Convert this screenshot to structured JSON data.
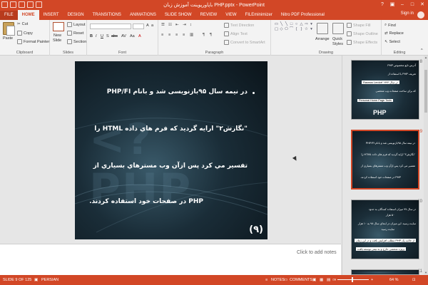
{
  "window": {
    "title": "PHP.pptx - PowerPoint",
    "title_rtl_prefix": "باپاورپوینت آموزش زبان"
  },
  "tabs": [
    "FILE",
    "HOME",
    "INSERT",
    "DESIGN",
    "TRANSITIONS",
    "ANIMATIONS",
    "SLIDE SHOW",
    "REVIEW",
    "VIEW",
    "FILEminimizer",
    "Nitro PDF Professional"
  ],
  "active_tab": "HOME",
  "account": {
    "signin": "Sign in"
  },
  "ribbon": {
    "clipboard": {
      "label": "Clipboard",
      "paste": "Paste",
      "cut": "Cut",
      "copy": "Copy",
      "format_painter": "Format Painter"
    },
    "slides": {
      "label": "Slides",
      "new_slide": "New",
      "new_slide2": "Slide",
      "layout": "Layout",
      "reset": "Reset",
      "section": "Section"
    },
    "font": {
      "label": "Font"
    },
    "paragraph": {
      "label": "Paragraph",
      "text_direction": "Text Direction",
      "align_text": "Align Text",
      "convert_smartart": "Convert to SmartArt"
    },
    "drawing": {
      "label": "Drawing",
      "arrange": "Arrange",
      "quick_styles": "Quick",
      "quick_styles2": "Styles",
      "shape_fill": "Shape Fill",
      "shape_outline": "Shape Outline",
      "shape_effects": "Shape Effects"
    },
    "editing": {
      "label": "Editing",
      "find": "Find",
      "replace": "Replace",
      "select": "Select"
    }
  },
  "slide": {
    "lines": [
      "در نیمه سال ۹۵بازنویسی شد و بانام PHP/FI",
      "\"نگارش۲\" ارایه گردید که فرم هاي داده HTML را",
      "تفسیر مي کرد پس ازآن وب مسترهاي بسیاري از",
      "PHP در صفحات خود استفاده کردند."
    ],
    "number": "(۹)",
    "background_word": "<? PHP"
  },
  "notes_placeholder": "Click to add notes",
  "thumbnails": [
    {
      "num": "8",
      "lines": [
        "آدرس تابع مخصوص PHP",
        "تعریف PHP با استفاده از",
        "Rasmus Lerdorf در سال ۱۹۹۴",
        "که برای ساخت صفحات وب شخصی",
        "Personal Home Page Tools"
      ],
      "badge": "PHP"
    },
    {
      "num": "9",
      "lines": [
        "در نیمه سال ۹۵بازنویسی شد و بانام PHP/FI",
        "\"نگارش۲\" ارایه گردید که فرم هاي داده HTML را",
        "تفسیر مي کرد پس ازآن وب مسترهاي بسیاري از",
        "PHP در صفحات خود استفاده کردند."
      ]
    },
    {
      "num": "10",
      "lines": [
        "در سال ۹۷ میزان استفاده کنندگان به حدود",
        "۵۰ هزار",
        "سایت رسید. این میزان در ابتدای سال ۹۸ به ۱۰ هزار",
        "سایت رسید",
        "مطلب افزایش یافت و در این زمان PHP از حالت یک",
        "پروژه شخصی خارج و به تیمی توسعه یافت"
      ]
    },
    {
      "num": "11",
      "lines": []
    }
  ],
  "status": {
    "slide_of": "SLIDE 9 OF 125",
    "language": "PERSIAN",
    "notes": "NOTES",
    "comments": "COMMENTS",
    "zoom": "64 %"
  },
  "colors": {
    "accent": "#d24726",
    "ribbon_bg": "#f3f3f3"
  }
}
